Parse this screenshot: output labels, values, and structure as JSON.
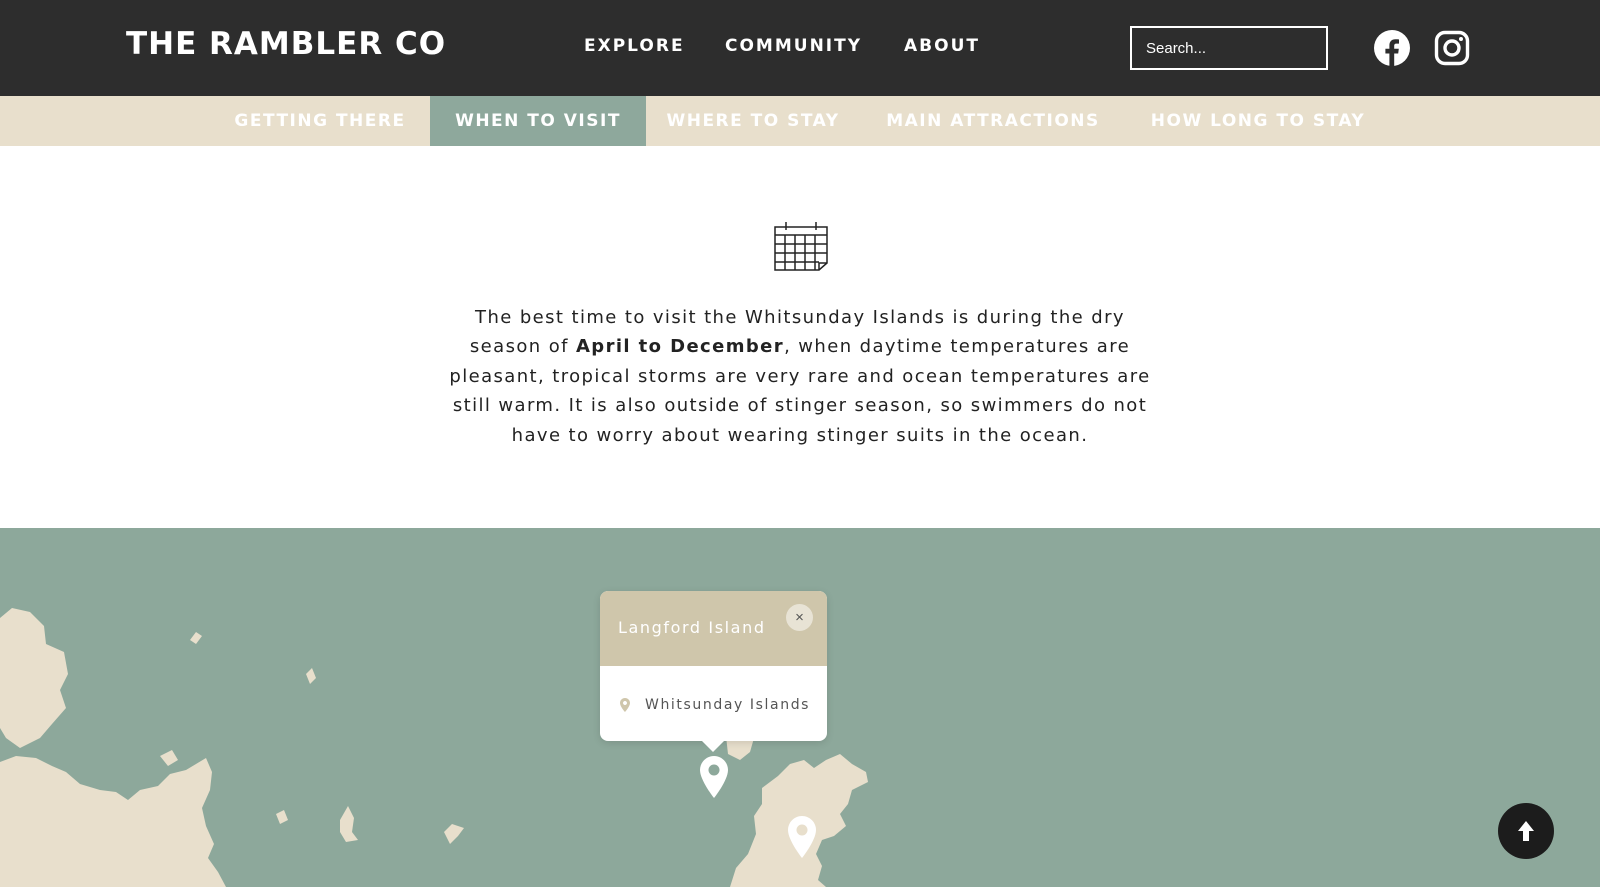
{
  "header": {
    "logo": "THE RAMBLER CO",
    "nav": [
      {
        "label": "EXPLORE"
      },
      {
        "label": "COMMUNITY"
      },
      {
        "label": "ABOUT"
      }
    ],
    "search": {
      "placeholder": "Search..."
    },
    "social_icons": [
      "facebook-icon",
      "instagram-icon"
    ]
  },
  "subnav": {
    "tabs": [
      {
        "label": "GETTING THERE",
        "active": false
      },
      {
        "label": "WHEN TO VISIT",
        "active": true
      },
      {
        "label": "WHERE TO STAY",
        "active": false
      },
      {
        "label": "MAIN ATTRACTIONS",
        "active": false
      },
      {
        "label": "HOW LONG TO STAY",
        "active": false
      }
    ]
  },
  "content": {
    "icon": "calendar-icon",
    "text_before": "The best time to visit the Whitsunday Islands is during the dry season of ",
    "text_bold": "April to December",
    "text_after": ", when daytime temperatures are pleasant, tropical storms are very rare and ocean temperatures are still warm. It is also outside of stinger season, so swimmers do not have to worry about wearing stinger suits in the ocean."
  },
  "map": {
    "popup": {
      "title": "Langford Island",
      "close": "×",
      "location": "Whitsunday Islands"
    },
    "pins": [
      "map-pin-icon",
      "map-pin-icon"
    ]
  },
  "scroll_top_icon": "arrow-up-icon",
  "colors": {
    "header_bg": "#2d2d2d",
    "subnav_bg": "#e8dfcc",
    "accent": "#8ea89c",
    "map_water": "#8da89b",
    "map_land": "#e8dfcc",
    "popup_header": "#cfc6ab"
  }
}
